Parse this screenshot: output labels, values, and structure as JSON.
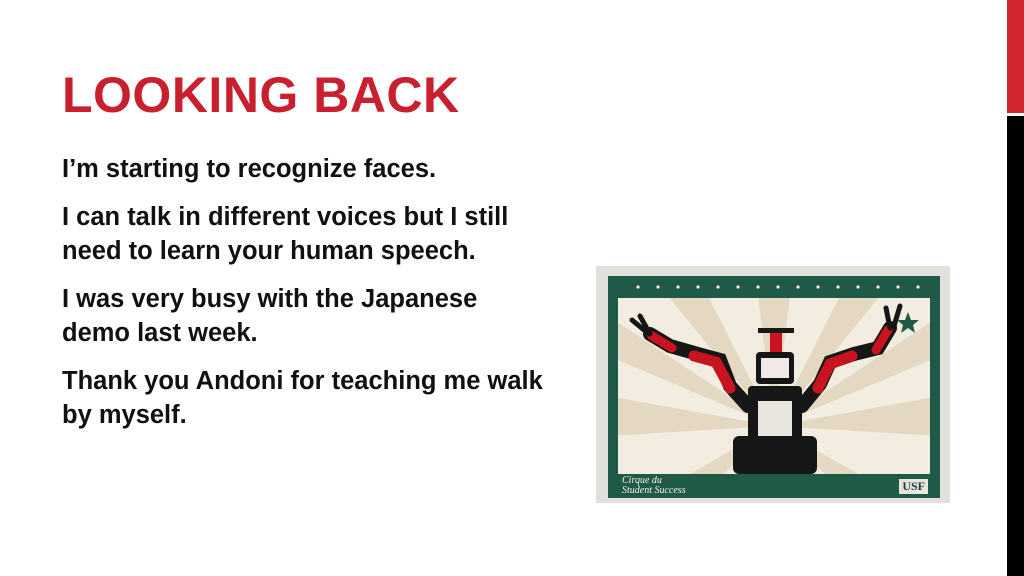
{
  "slide": {
    "title": "LOOKING BACK",
    "bullets": [
      "I’m starting to recognize faces.",
      "I can talk in different voices but I still need to learn your human speech.",
      "I was very busy with the Japanese demo last week.",
      "Thank you Andoni for teaching me walk by myself."
    ]
  },
  "photo": {
    "caption_left": "Cirque du\nStudent Success",
    "caption_right": "USF"
  },
  "colors": {
    "title": "#c8202f",
    "accent_bar_top": "#d0282e",
    "accent_bar_bottom": "#000000",
    "card_border": "#1f5a48",
    "robot_red": "#c8141e",
    "robot_black": "#161616"
  }
}
